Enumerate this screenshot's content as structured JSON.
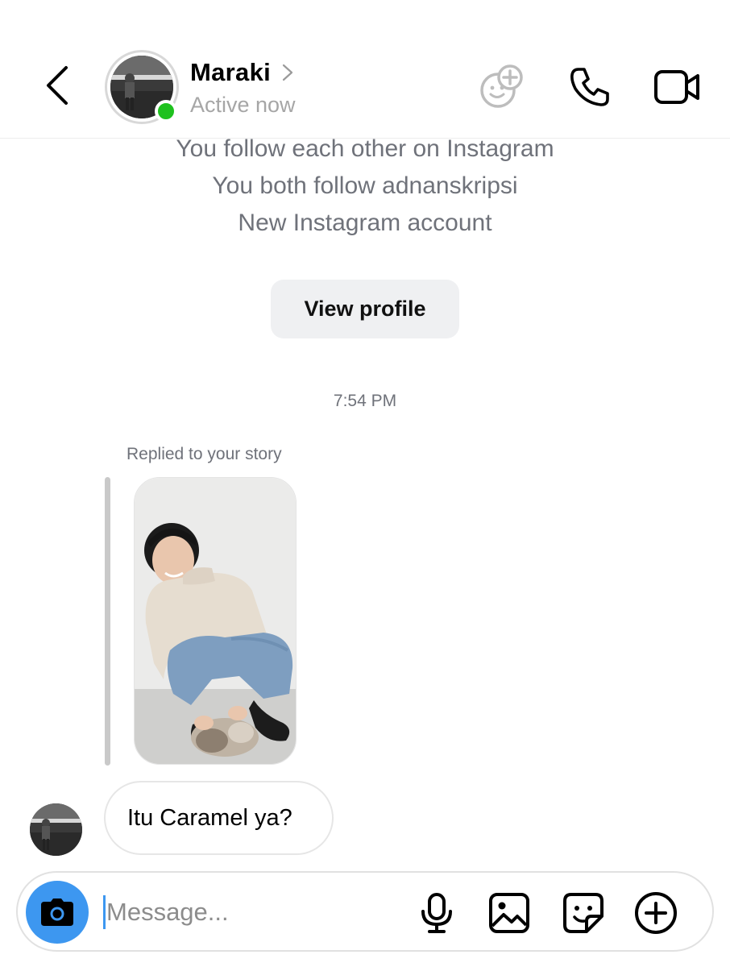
{
  "header": {
    "name": "Maraki",
    "status": "Active now"
  },
  "profile_info": {
    "lines": [
      "You follow each other on Instagram",
      "You both follow adnanskripsi",
      "New Instagram account"
    ],
    "view_profile_label": "View profile"
  },
  "conversation": {
    "timestamp": "7:54 PM",
    "story_reply_label": "Replied to your story",
    "messages": [
      {
        "sender": "Maraki",
        "text": "Itu Caramel ya?"
      }
    ]
  },
  "composer": {
    "placeholder": "Message...",
    "value": ""
  },
  "colors": {
    "online": "#1ec11e",
    "accent": "#3d97f0",
    "secondary_text": "#6f727a"
  },
  "icons": [
    "back-arrow-icon",
    "chevron-right-icon",
    "add-friends-icon",
    "phone-icon",
    "video-camera-icon",
    "camera-icon",
    "microphone-icon",
    "gallery-icon",
    "sticker-icon",
    "plus-circle-icon"
  ]
}
